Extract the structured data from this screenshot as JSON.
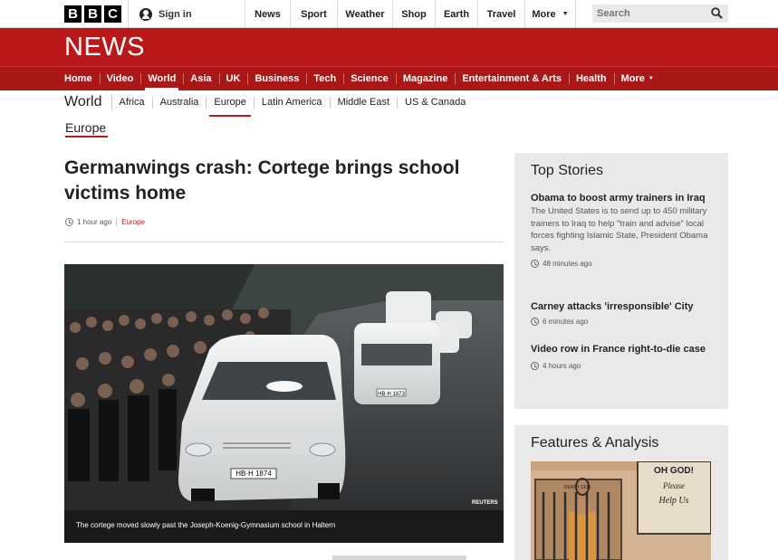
{
  "brand": {
    "letters": [
      "B",
      "B",
      "C"
    ]
  },
  "header": {
    "sign_in": "Sign in",
    "top_nav": [
      "News",
      "Sport",
      "Weather",
      "Shop",
      "Earth",
      "Travel",
      "More"
    ],
    "search_placeholder": "Search",
    "news_title": "NEWS"
  },
  "main_nav": [
    "Home",
    "Video",
    "World",
    "Asia",
    "UK",
    "Business",
    "Tech",
    "Science",
    "Magazine",
    "Entertainment & Arts",
    "Health",
    "More"
  ],
  "sub_nav": {
    "title": "World",
    "items": [
      "Africa",
      "Australia",
      "Europe",
      "Latin America",
      "Middle East",
      "US & Canada"
    ]
  },
  "section_label": "Europe",
  "article": {
    "headline": "Germanwings crash: Cortege brings school victims home",
    "time": "1 hour ago",
    "tag": "Europe",
    "photo_credit": "REUTERS",
    "plate_front": "HB·H 1874",
    "plate_second": "HB·H 1873",
    "caption": "The cortege moved slowly past the Joseph-Koenig-Gymnasium school in Haltern"
  },
  "top_stories": {
    "title": "Top Stories",
    "items": [
      {
        "headline": "Obama to boost army trainers in Iraq",
        "summary": "The United States is to send up to 450 military trainers to Iraq to help \"train and advise\" local forces fighting Islamic State, President Obama says.",
        "time": "48 minutes ago"
      },
      {
        "headline": "Carney attacks 'irresponsible' City",
        "time": "6 minutes ago"
      },
      {
        "headline": "Video row in France right-to-die case",
        "time": "4 hours ago"
      }
    ]
  },
  "features": {
    "title": "Features & Analysis",
    "sign_line1": "OH GOD!",
    "sign_line2": "Please",
    "sign_line3": "Help Us",
    "cell_label": "DEATH CELL"
  },
  "colors": {
    "accent": "#bb1919",
    "nav_band": "#a91717",
    "panel_bg": "#e9e9e9"
  }
}
